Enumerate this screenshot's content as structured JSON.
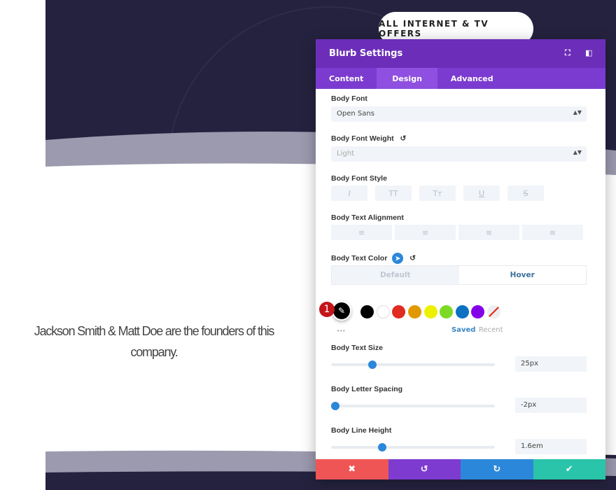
{
  "page": {
    "cta_label": "ALL INTERNET & TV OFFERS",
    "quote": "Jackson Smith & Matt Doe are the founders of this company."
  },
  "panel": {
    "title": "Blurb Settings",
    "header_icons": [
      "fullscreen-icon",
      "sidebar-toggle-icon"
    ],
    "tabs": [
      {
        "label": "Content"
      },
      {
        "label": "Design",
        "active": true
      },
      {
        "label": "Advanced"
      }
    ],
    "body_font": {
      "label": "Body Font",
      "value": "Open Sans"
    },
    "body_font_weight": {
      "label": "Body Font Weight",
      "value": "Light"
    },
    "body_font_style": {
      "label": "Body Font Style",
      "buttons": [
        "I",
        "TT",
        "Tт",
        "U",
        "S"
      ]
    },
    "body_text_alignment": {
      "label": "Body Text Alignment",
      "buttons": [
        "≡",
        "≡",
        "≡",
        "≡"
      ]
    },
    "body_text_color": {
      "label": "Body Text Color",
      "toggle": {
        "default": "Default",
        "hover": "Hover",
        "active": "Hover"
      },
      "badge": "1",
      "swatches": [
        "#000000",
        "#ffffff",
        "#e02b20",
        "#e09900",
        "#edf000",
        "#7cda24",
        "#0c71c3",
        "#8300e9"
      ],
      "saved": "Saved",
      "recent": "Recent",
      "more": "•••"
    },
    "body_text_size": {
      "label": "Body Text Size",
      "value": "25px",
      "fraction": 0.25
    },
    "body_letter_spacing": {
      "label": "Body Letter Spacing",
      "value": "-2px",
      "fraction": 0.0
    },
    "body_line_height": {
      "label": "Body Line Height",
      "value": "1.6em",
      "fraction": 0.31
    },
    "footer": {
      "cancel": "✖",
      "undo": "↺",
      "redo": "↻",
      "save": "✔"
    },
    "colors": {
      "header": "#6c2eb9",
      "tabs": "#7b3bd0",
      "accent": "#2b87da",
      "cancel": "#ef5555",
      "undo": "#7e3bd0",
      "redo": "#2b87da",
      "save": "#29c4a9"
    }
  }
}
